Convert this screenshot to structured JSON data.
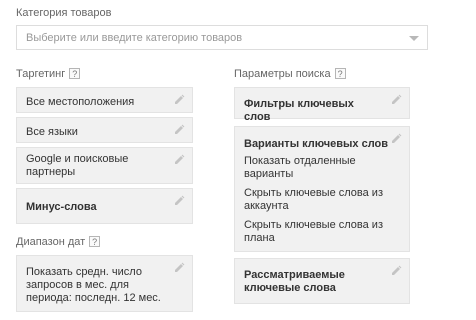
{
  "category": {
    "label": "Категория товаров",
    "placeholder": "Выберите или введите категорию товаров"
  },
  "targeting": {
    "label": "Таргетинг",
    "help": "?",
    "items": [
      {
        "label": "Все местоположения"
      },
      {
        "label": "Все языки"
      },
      {
        "label": "Google и поисковые партнеры"
      },
      {
        "label": "Минус-слова"
      }
    ]
  },
  "date_range": {
    "label": "Диапазон дат",
    "help": "?",
    "value": "Показать средн. число запросов в мес. для периода: последн. 12 мес."
  },
  "search_params": {
    "label": "Параметры поиска",
    "help": "?",
    "filters": "Фильтры ключевых слов",
    "variants": {
      "title": "Варианты ключевых слов",
      "options": [
        "Показать отдаленные варианты",
        "Скрыть ключевые слова из аккаунта",
        "Скрыть ключевые слова из плана"
      ]
    },
    "considered": "Рассматриваемые ключевые слова"
  },
  "icons": {
    "edit": "pencil-icon",
    "dropdown": "caret-down-icon",
    "help": "help-icon"
  },
  "colors": {
    "card_bg": "#f1f1f1",
    "card_border": "#e3e3e3",
    "label_text": "#666666",
    "placeholder_text": "#999999"
  }
}
